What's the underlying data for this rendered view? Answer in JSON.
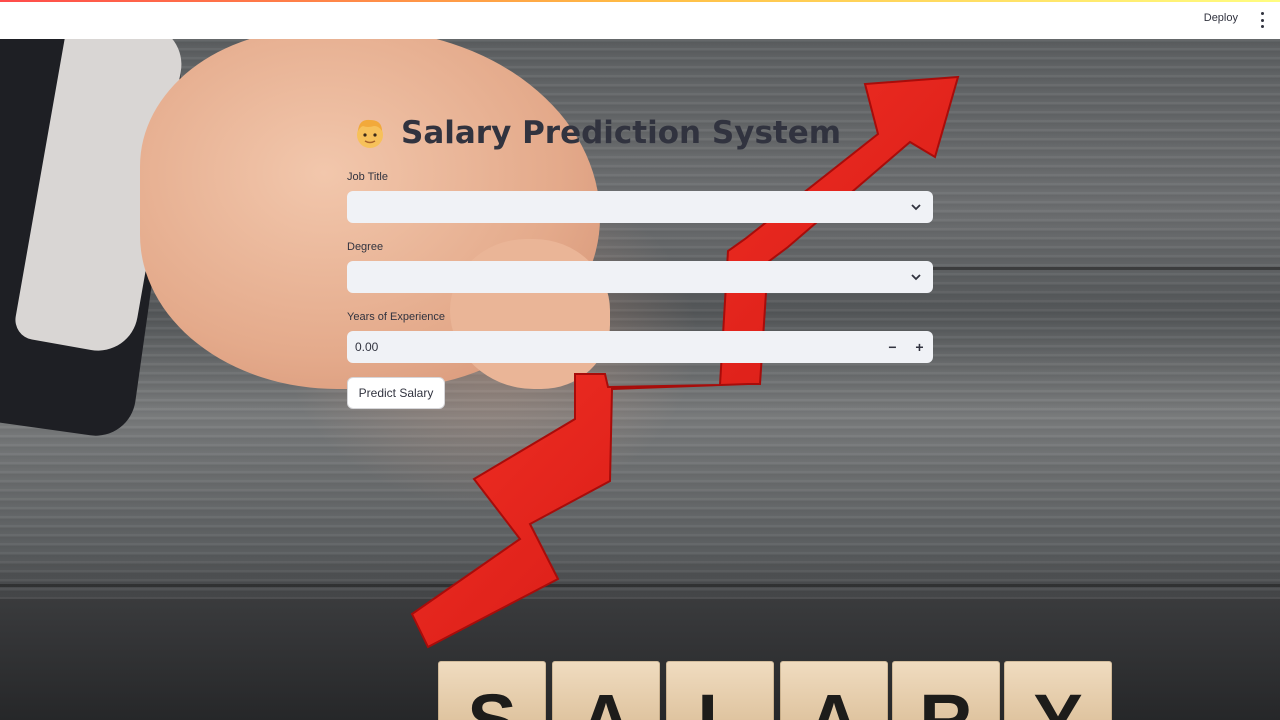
{
  "toolbar": {
    "deploy_label": "Deploy",
    "menu_icon": "vertical-ellipsis-icon",
    "accent_gradient": [
      "#ff4b4b",
      "#ffbd45",
      "#fffd80"
    ]
  },
  "app": {
    "title_icon": "person-emoji-icon",
    "title": "Salary Prediction System",
    "fields": {
      "job_title": {
        "label": "Job Title",
        "value": ""
      },
      "degree": {
        "label": "Degree",
        "value": ""
      },
      "experience": {
        "label": "Years of Experience",
        "value": "0.00",
        "decrement": "−",
        "increment": "+"
      }
    },
    "predict_button": "Predict Salary"
  },
  "background": {
    "description_icon": "upward-red-arrow-hand-photo",
    "blocks": [
      "S",
      "A",
      "L",
      "A",
      "R",
      "Y"
    ],
    "arrow_color": "#e8201d"
  },
  "colors": {
    "input_bg": "#f0f2f6",
    "text": "#31333f"
  }
}
